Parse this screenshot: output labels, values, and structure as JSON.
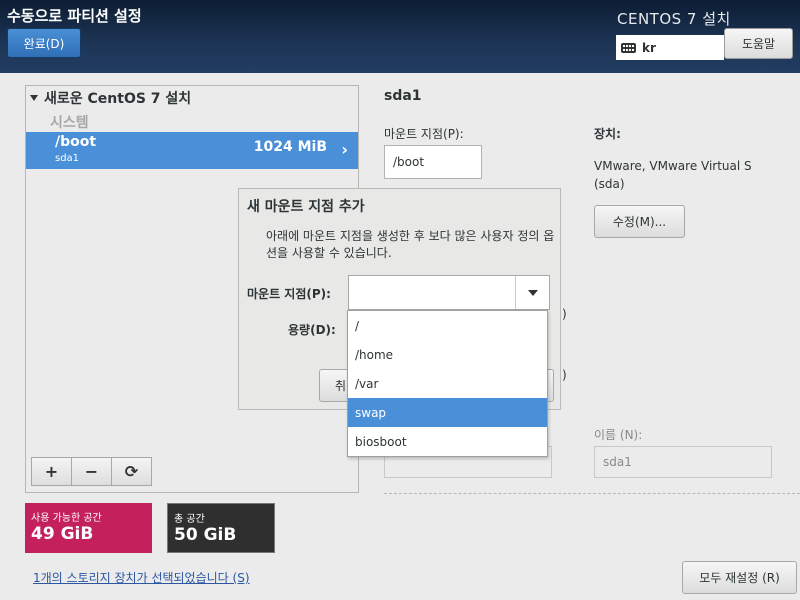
{
  "header": {
    "title": "수동으로 파티션 설정",
    "done_label": "완료(D)",
    "product": "CENTOS 7 설치",
    "keyboard_layout": "kr",
    "help_label": "도움말",
    "gradient_colors": [
      "#0d1d33",
      "#223d62"
    ]
  },
  "left": {
    "install_title": "새로운 CentOS 7 설치",
    "system_label": "시스템",
    "partitions": [
      {
        "mount": "/boot",
        "device": "sda1",
        "size": "1024 MiB",
        "selected": true
      }
    ],
    "toolbar": {
      "add": "+",
      "remove": "−",
      "refresh": "⟳"
    }
  },
  "space": {
    "available_label": "사용 가능한 공간",
    "available_value": "49 GiB",
    "total_label": "총 공간",
    "total_value": "50 GiB",
    "available_color": "#c4205c",
    "total_color": "#2f2f2f"
  },
  "storage_link": "1개의 스토리지 장치가 선택되었습니다 (S)",
  "reset_label": "모두 재설정 (R)",
  "right": {
    "title": "sda1",
    "mount_label": "마운트 지점(P):",
    "mount_value": "/boot",
    "device_label": "장치:",
    "device_value": "VMware, VMware Virtual S (sda)",
    "modify_label": "수정(M)...",
    "name_label": "이름 (N):",
    "name_value": "sda1"
  },
  "dialog": {
    "title": "새 마운트 지점 추가",
    "description": "아래에 마운트 지점을 생성한 후 보다 많은 사용자 정의 옵션을 사용할 수 있습니다.",
    "mount_label": "마운트 지점(P):",
    "capacity_label": "용량(D):",
    "cancel_label": "취",
    "mount_options": [
      "/",
      "/home",
      "/var",
      "swap",
      "biosboot"
    ],
    "highlighted_option": "swap",
    "accent_color": "#4a90d9"
  }
}
